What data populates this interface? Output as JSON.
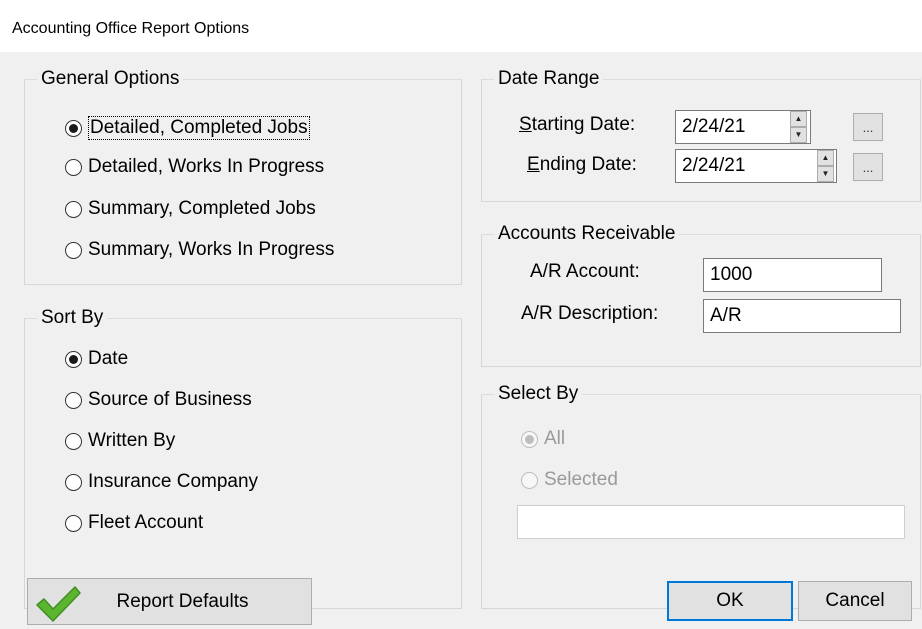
{
  "window": {
    "title": "Accounting Office Report Options"
  },
  "general_options": {
    "legend": "General Options",
    "items": [
      {
        "label": "Detailed, Completed Jobs",
        "selected": true
      },
      {
        "label": "Detailed, Works In Progress",
        "selected": false
      },
      {
        "label": "Summary, Completed Jobs",
        "selected": false
      },
      {
        "label": "Summary, Works In Progress",
        "selected": false
      }
    ]
  },
  "sort_by": {
    "legend": "Sort By",
    "items": [
      {
        "label": "Date",
        "selected": true
      },
      {
        "label": "Source of Business",
        "selected": false
      },
      {
        "label": "Written By",
        "selected": false
      },
      {
        "label": "Insurance Company",
        "selected": false
      },
      {
        "label": "Fleet Account",
        "selected": false
      }
    ]
  },
  "date_range": {
    "legend": "Date Range",
    "starting_label_first": "S",
    "starting_label_rest": "tarting Date:",
    "starting_value": "2/24/21",
    "ending_label_first": "E",
    "ending_label_rest": "nding Date:",
    "ending_value": "2/24/21",
    "picker_label": "..."
  },
  "accounts_receivable": {
    "legend": "Accounts Receivable",
    "account_label": "A/R Account:",
    "account_value": "1000",
    "description_label": "A/R Description:",
    "description_value": "A/R"
  },
  "select_by": {
    "legend": "Select By",
    "all_label": "All",
    "selected_label": "Selected",
    "selected_value": ""
  },
  "buttons": {
    "report_defaults": "Report Defaults",
    "ok": "OK",
    "cancel": "Cancel"
  },
  "colors": {
    "accent": "#0078d7",
    "check": "#5cb531"
  }
}
